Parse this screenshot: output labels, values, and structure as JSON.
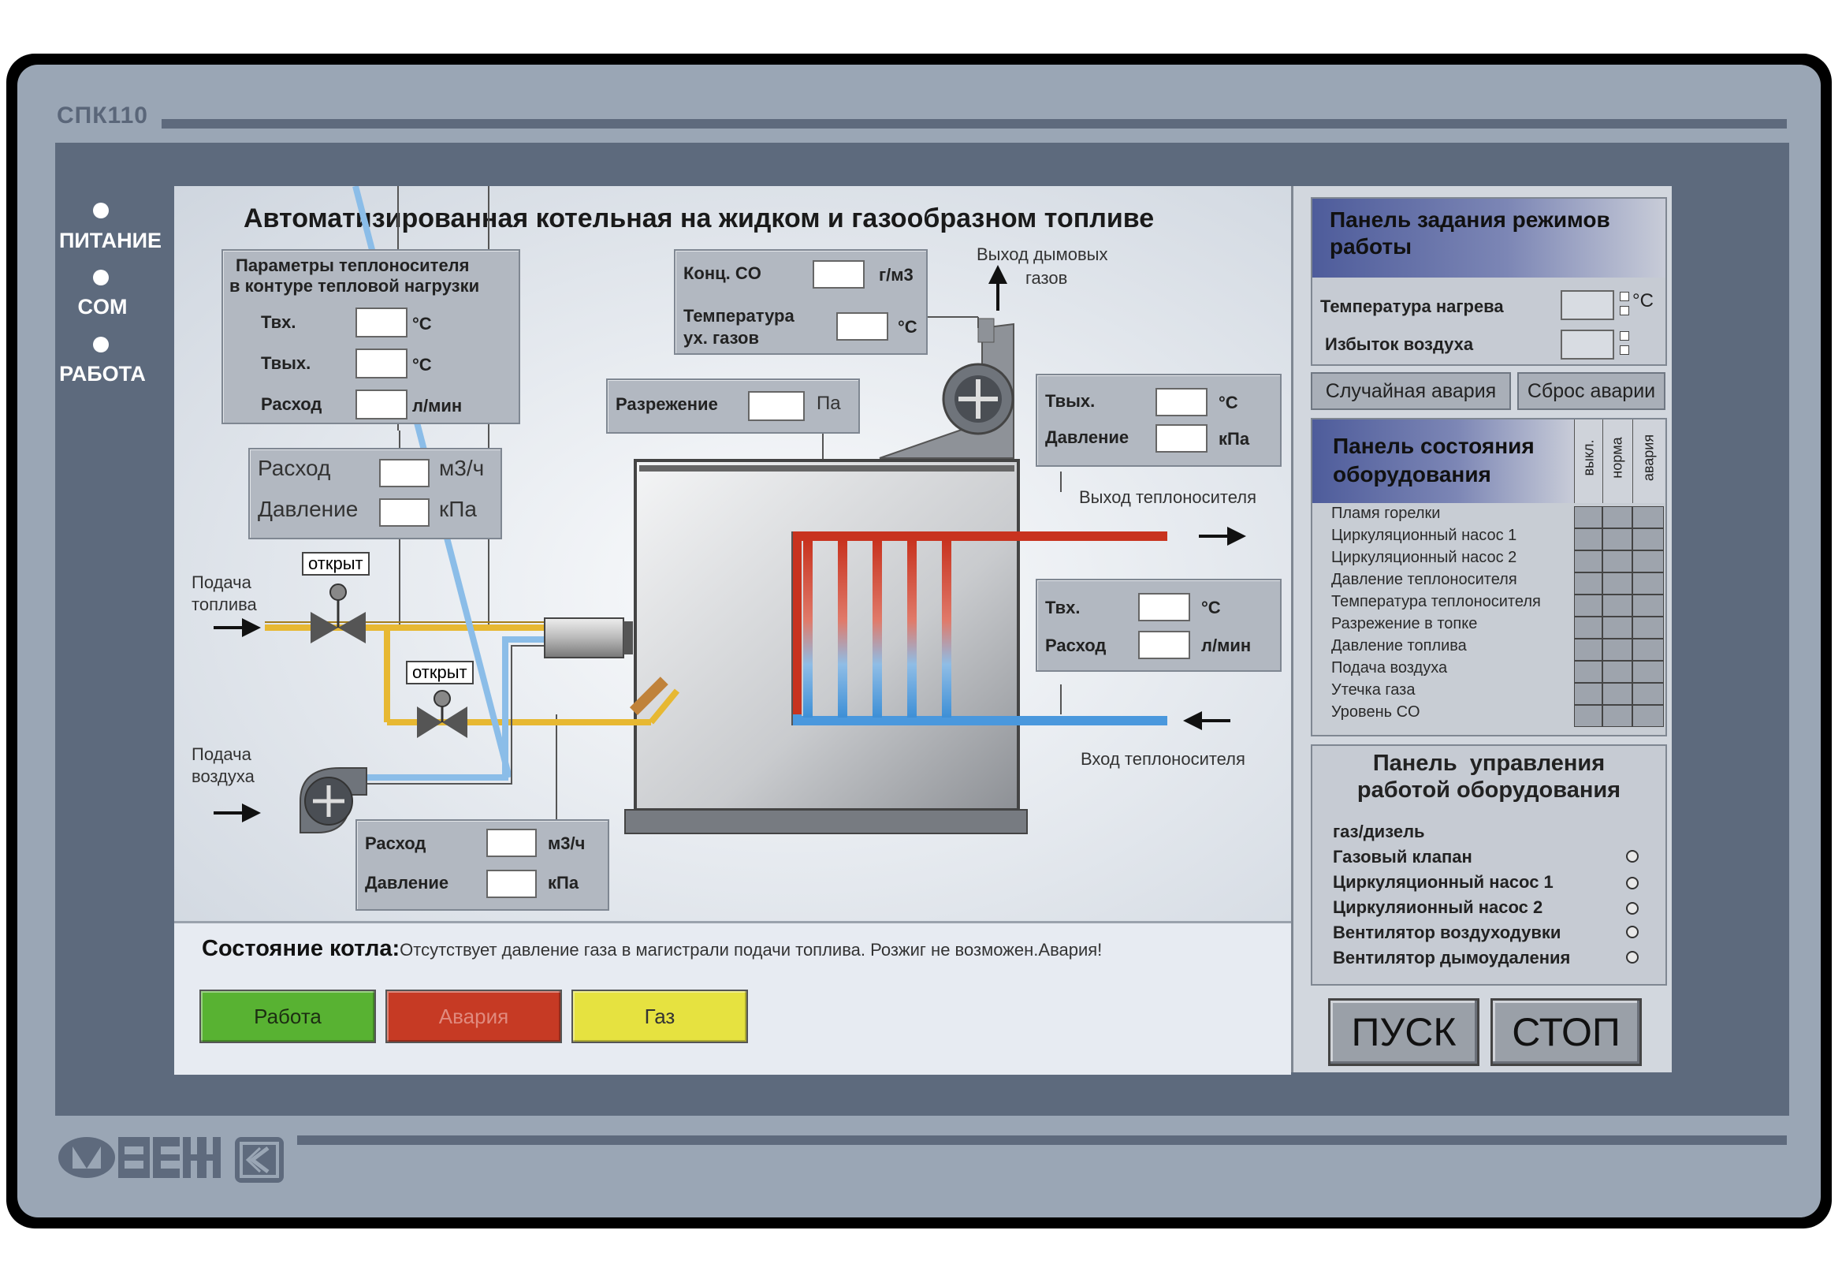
{
  "device": {
    "model": "СПК110",
    "brand": "ОВЕН"
  },
  "leds": [
    {
      "label": "ПИТАНИЕ"
    },
    {
      "label": "COM"
    },
    {
      "label": "РАБОТА"
    }
  ],
  "screen": {
    "title": "Автоматизированная котельная на жидком и газообразном топливе",
    "heat_params_panel": {
      "title_line1": "Параметры теплоносителя",
      "title_line2": "в контуре тепловой нагрузки",
      "rows": [
        {
          "label": "Твх.",
          "unit": "°С"
        },
        {
          "label": "Твых.",
          "unit": "°С"
        },
        {
          "label": "Расход",
          "unit": "л/мин"
        }
      ]
    },
    "co_panel": {
      "co_label": "Конц. CO",
      "co_unit": "г/м3",
      "temp_label_line1": "Температура",
      "temp_label_line2": "ух. газов",
      "temp_unit": "°С"
    },
    "smoke_outlet": {
      "line1": "Выход дымовых",
      "line2": "газов"
    },
    "vacuum_panel": {
      "label": "Разрежение",
      "unit": "Па"
    },
    "outlet_panel": {
      "rows": [
        {
          "label": "Твых.",
          "unit": "°С"
        },
        {
          "label": "Давление",
          "unit": "кПа"
        }
      ]
    },
    "coolant_out_label": "Выход теплоносителя",
    "inlet_panel": {
      "rows": [
        {
          "label": "Твх.",
          "unit": "°С"
        },
        {
          "label": "Расход",
          "unit": "л/мин"
        }
      ]
    },
    "coolant_in_label": "Вход теплоносителя",
    "fuel_flow_panel": {
      "rows": [
        {
          "label": "Расход",
          "unit": "м3/ч"
        },
        {
          "label": "Давление",
          "unit": "кПа"
        }
      ]
    },
    "valve1_state": "открыт",
    "valve2_state": "открыт",
    "fuel_supply": {
      "line1": "Подача",
      "line2": "топлива"
    },
    "air_supply": {
      "line1": "Подача",
      "line2": "воздуха"
    },
    "air_flow_panel": {
      "rows": [
        {
          "label": "Расход",
          "unit": "м3/ч"
        },
        {
          "label": "Давление",
          "unit": "кПа"
        }
      ]
    },
    "status": {
      "label": "Состояние котла:",
      "message": "Отсутствует давление газа в магистрали подачи топлива. Розжиг не возможен.Авария!",
      "buttons": [
        {
          "label": "Работа",
          "color": "#58b232"
        },
        {
          "label": "Авария",
          "color": "#c63a24"
        },
        {
          "label": "Газ",
          "color": "#e6e240"
        }
      ]
    }
  },
  "right_panel": {
    "mode_panel": {
      "title": "Панель задания режимов работы",
      "rows": [
        {
          "label": "Температура нагрева",
          "unit": "°С"
        },
        {
          "label": "Избыток воздуха",
          "unit": ""
        }
      ]
    },
    "random_fault_button": "Случайная авария",
    "reset_fault_button": "Сброс аварии",
    "state_panel": {
      "title": "Панель состояния оборудования",
      "columns": [
        "выкл.",
        "норма",
        "авария"
      ],
      "items": [
        "Пламя горелки",
        "Циркуляционный насос 1",
        "Циркуляционный насос 2",
        "Давление теплоносителя",
        "Температура теплоносителя",
        "Разрежение в топке",
        "Давление топлива",
        "Подача воздуха",
        "Утечка газа",
        "Уровень CO"
      ]
    },
    "control_panel": {
      "title_line1": "Панель  управления",
      "title_line2": "работой оборудования",
      "items": [
        {
          "label": "газ/дизель",
          "has_radio": false
        },
        {
          "label": "Газовый клапан",
          "has_radio": true
        },
        {
          "label": "Циркуляционный насос 1",
          "has_radio": true
        },
        {
          "label": "Циркуляионный насос 2",
          "has_radio": true
        },
        {
          "label": "Вентилятор воздуходувки",
          "has_radio": true
        },
        {
          "label": "Вентилятор дымоудаления",
          "has_radio": true
        }
      ]
    },
    "start_button": "ПУСК",
    "stop_button": "СТОП"
  }
}
